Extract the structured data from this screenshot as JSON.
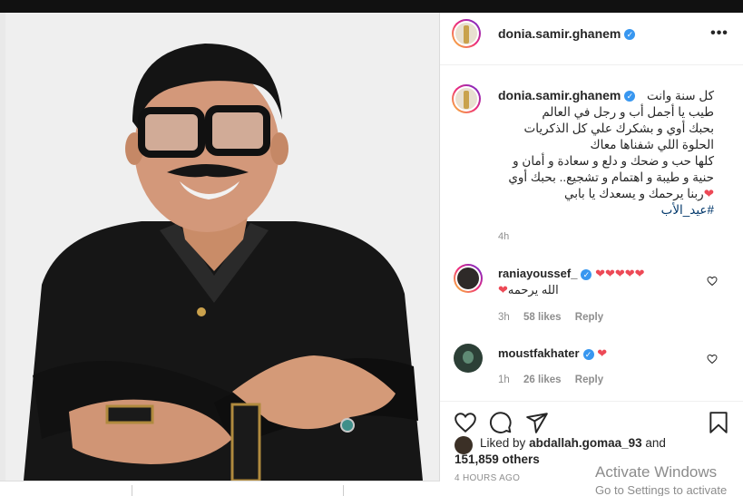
{
  "post": {
    "username": "donia.samir.ghanem",
    "more_icon": "more-horizontal-icon",
    "caption_lines": [
      "كل سنة وانت",
      "طيب يا أجمل أب و رجل في العالم",
      "بحبك أوي و بشكرك علي كل الذكريات",
      "الحلوة اللي شفناها معاك",
      "كلها حب و ضحك و دلع و سعادة و أمان و",
      "حنية و طيبة و اهتمام و تشجيع.. بحبك أوي",
      "ربنا يرحمك و يسعدك يا بابي"
    ],
    "hashtag": "#عيد_الأب",
    "caption_time": "4h"
  },
  "comments": [
    {
      "username": "raniayoussef_",
      "hearts": "❤❤❤❤❤",
      "text": "الله يرحمه",
      "text_heart": "❤",
      "time": "3h",
      "likes": "58 likes",
      "reply": "Reply"
    },
    {
      "username": "moustfakhater",
      "hearts": "❤",
      "text": "",
      "time": "1h",
      "likes": "26 likes",
      "reply": "Reply"
    }
  ],
  "actions": {
    "like_icon": "heart-outline-icon",
    "comment_icon": "comment-icon",
    "share_icon": "share-icon",
    "save_icon": "bookmark-icon"
  },
  "likes": {
    "prefix": "Liked by",
    "user": "abdallah.gomaa_93",
    "and": "and",
    "count": "151,859 others"
  },
  "posted": "4 HOURS AGO",
  "watermark": {
    "line1": "Activate Windows",
    "line2": "Go to Settings to activate"
  },
  "colors": {
    "heart": "#ed4956",
    "verified": "#3897f0",
    "hashtag": "#00376b",
    "muted": "#8e8e8e"
  }
}
